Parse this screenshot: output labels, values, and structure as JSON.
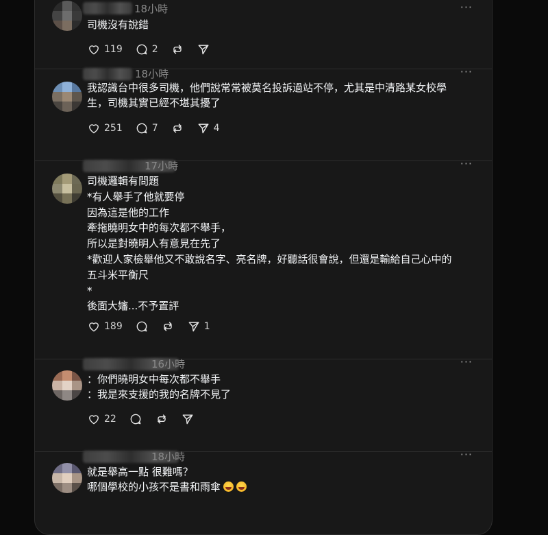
{
  "posts": [
    {
      "time": "18小時",
      "lines": [
        "司機沒有說錯"
      ],
      "likes": "119",
      "comments": "2",
      "reposts": "",
      "shares": ""
    },
    {
      "time": "18小時",
      "lines": [
        "我認識台中很多司機，他們說常常被莫名投訴過站不停，尤其是中清路某女校學",
        "生，司機其實已經不堪其擾了"
      ],
      "likes": "251",
      "comments": "7",
      "reposts": "",
      "shares": "4"
    },
    {
      "time": "17小時",
      "lines": [
        "司機邏輯有問題",
        "*有人舉手了他就要停",
        "因為這是他的工作",
        "牽拖曉明女中的每次都不舉手，",
        "所以是對曉明人有意見在先了",
        "*歡迎人家檢舉他又不敢說名字、亮名牌，好聽話很會說，但還是輸給自己心中的",
        "五斗米平衡尺",
        "*",
        "後面大嬸...不予置評"
      ],
      "likes": "189",
      "comments": "",
      "reposts": "",
      "shares": "1"
    },
    {
      "time": "16小時",
      "lines": [
        "：你們曉明女中每次都不舉手",
        "：我是來支援的我的名牌不見了"
      ],
      "likes": "22",
      "comments": "",
      "reposts": "",
      "shares": ""
    },
    {
      "time": "18小時",
      "lines": [
        "就是舉高一點 很難嗎？",
        "哪個學校的小孩不是書和雨傘"
      ],
      "emoji_count": 2
    }
  ],
  "more_label": "···",
  "colors": {
    "bg": "#0a0a0a",
    "panel": "#181818",
    "divider": "#2d2d2d",
    "text": "#f3f5f7",
    "muted": "#8a8a8a"
  },
  "icons": [
    "heart-icon",
    "comment-icon",
    "repost-icon",
    "share-icon",
    "more-icon",
    "laughing-emoji-icon"
  ]
}
